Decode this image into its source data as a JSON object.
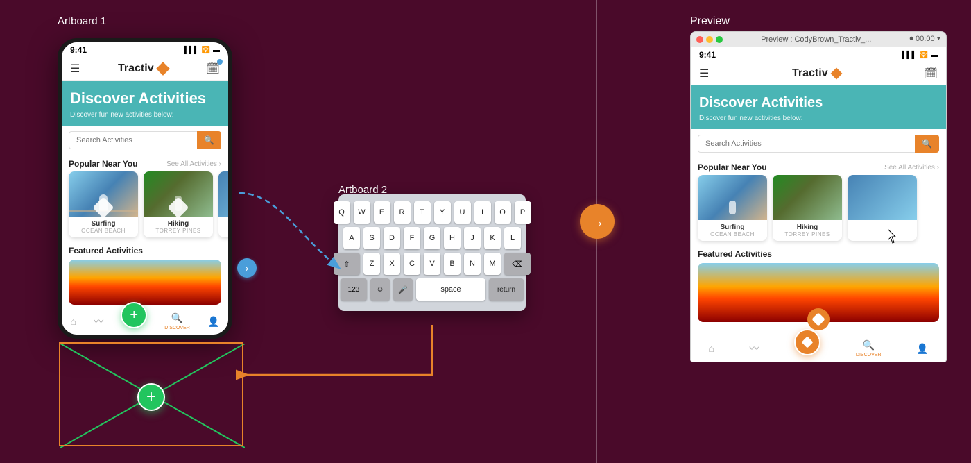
{
  "artboard1": {
    "label": "Artboard 1",
    "phone": {
      "time": "9:41",
      "app_name": "Tractiv",
      "hero_title": "Discover Activities",
      "hero_subtitle": "Discover fun new activities below:",
      "search_placeholder": "Search Activities",
      "popular_title": "Popular Near You",
      "see_all": "See All Activities",
      "activities": [
        {
          "name": "Surfing",
          "location": "OCEAN BEACH"
        },
        {
          "name": "Hiking",
          "location": "TORREY PINES"
        }
      ],
      "featured_title": "Featured Activities",
      "nav_items": [
        "home",
        "activity",
        "discover",
        "profile"
      ]
    }
  },
  "artboard2": {
    "label": "Artboard 2",
    "keyboard_rows": [
      [
        "Q",
        "W",
        "E",
        "R",
        "T",
        "Y",
        "U",
        "I",
        "O",
        "P"
      ],
      [
        "A",
        "S",
        "D",
        "F",
        "G",
        "H",
        "J",
        "K",
        "L"
      ],
      [
        "⇧",
        "Z",
        "X",
        "C",
        "V",
        "B",
        "N",
        "M",
        "⌫"
      ],
      [
        "123",
        "😊",
        "🎤",
        "space",
        "return"
      ]
    ]
  },
  "preview": {
    "label": "Preview",
    "titlebar": {
      "title": "Preview : CodyBrown_Tractiv_...",
      "time_display": "00:00"
    },
    "phone": {
      "time": "9:41",
      "app_name": "Tractiv",
      "hero_title": "Discover Activities",
      "hero_subtitle": "Discover fun new activities below:",
      "search_placeholder": "Search Activities",
      "popular_title": "Popular Near You",
      "see_all": "See All Activities",
      "featured_title": "Featured Activities",
      "nav_discover_label": "DISCOVER"
    }
  },
  "colors": {
    "bg": "#4a0a2a",
    "teal": "#4ab5b5",
    "orange": "#e8832a",
    "green": "#22c55e",
    "blue_arrow": "#4a9eda"
  }
}
